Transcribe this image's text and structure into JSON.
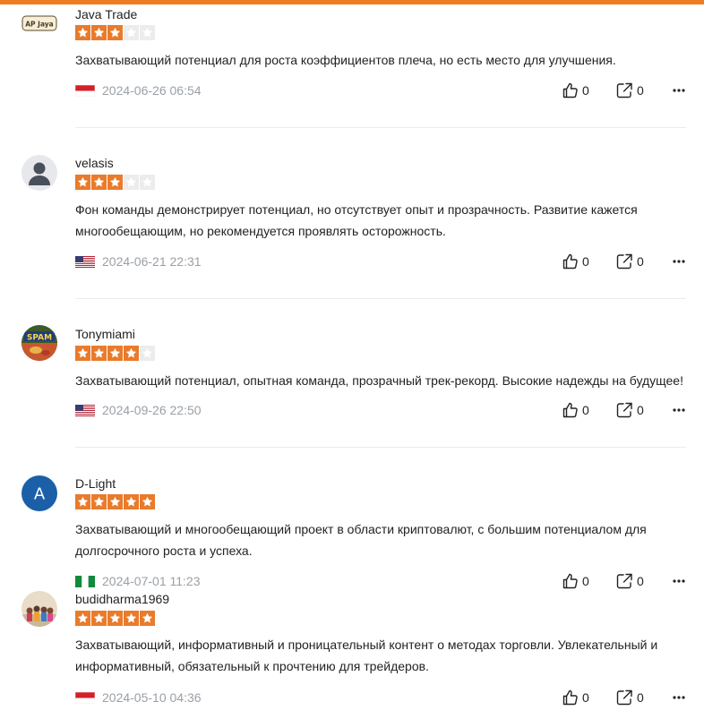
{
  "colors": {
    "accent": "#f07c22",
    "star_on": "#e97b2b",
    "star_off": "#ececec"
  },
  "icons": {
    "like": "thumbs-up-icon",
    "share": "share-icon",
    "more": "more-dots-icon"
  },
  "reviews": [
    {
      "username": "Java Trade",
      "avatar": "ap-jaya-logo",
      "rating": 3,
      "text": "Захватывающий потенциал для роста коэффициентов плеча, но есть место для улучшения.",
      "country": "Indonesia",
      "date": "2024-06-26 06:54",
      "likes": "0",
      "shares": "0"
    },
    {
      "username": "velasis",
      "avatar": "default-user",
      "rating": 3,
      "text": "Фон команды демонстрирует потенциал, но отсутствует опыт и прозрачность. Развитие кажется многообещающим, но рекомендуется проявлять осторожность.",
      "country": "United States",
      "date": "2024-06-21 22:31",
      "likes": "0",
      "shares": "0"
    },
    {
      "username": "Tonymiami",
      "avatar": "spam-can-photo",
      "rating": 4,
      "text": "Захватывающий потенциал, опытная команда, прозрачный трек-рекорд. Высокие надежды на будущее!",
      "country": "United States",
      "date": "2024-09-26 22:50",
      "likes": "0",
      "shares": "0"
    },
    {
      "username": "D-Light",
      "avatar": "letter-avatar",
      "avatar_letter": "A",
      "rating": 5,
      "text": "Захватывающий и многообещающий проект в области криптовалют, с большим потенциалом для долгосрочного роста и успеха.",
      "country": "Nigeria",
      "date": "2024-07-01 11:23",
      "likes": "0",
      "shares": "0"
    },
    {
      "username": "budidharma1969",
      "avatar": "group-photo",
      "rating": 5,
      "text": "Захватывающий, информативный и проницательный контент о методах торговли. Увлекательный и информативный, обязательный к прочтению для трейдеров.",
      "country": "Indonesia",
      "date": "2024-05-10 04:36",
      "likes": "0",
      "shares": "0"
    }
  ]
}
